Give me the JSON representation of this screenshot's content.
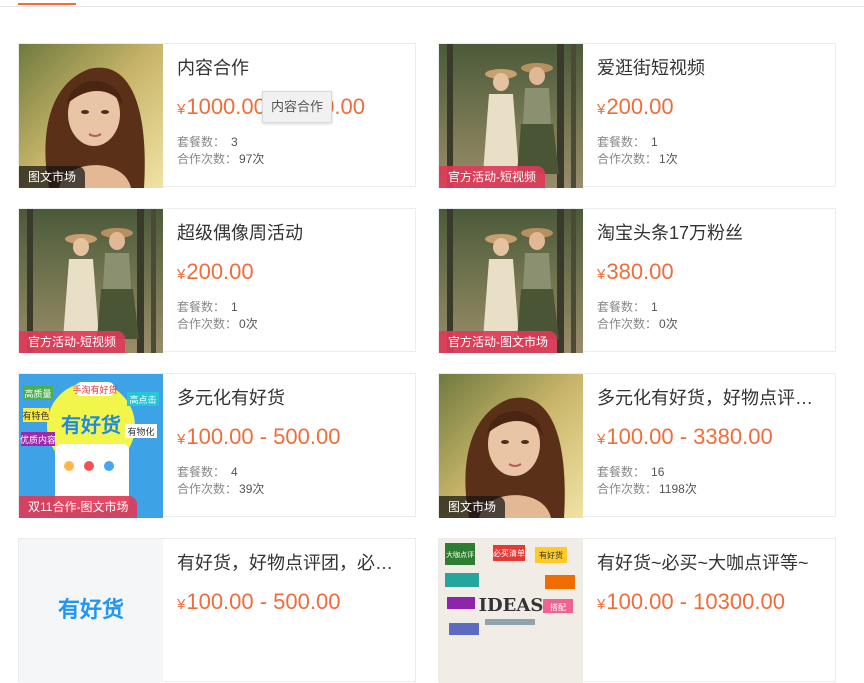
{
  "colors": {
    "accent": "#ef6d3a",
    "badge_dark": "#222222",
    "badge_red": "#de3a58"
  },
  "labels": {
    "package_count": "套餐数：",
    "cooperation_count": "合作次数：",
    "currency": "¥"
  },
  "tooltip": "内容合作",
  "cards": [
    {
      "title": "内容合作",
      "price": "1000.00 - 5000.00",
      "packages": "3",
      "cooperations": "97次",
      "badge": "图文市场",
      "image": "woman-portrait-photo"
    },
    {
      "title": "爱逛街短视频",
      "price": "200.00",
      "packages": "1",
      "cooperations": "1次",
      "badge": "官方活动-短视频",
      "image": "two-women-forest-photo"
    },
    {
      "title": "超级偶像周活动",
      "price": "200.00",
      "packages": "1",
      "cooperations": "0次",
      "badge": "官方活动-短视频",
      "image": "two-women-forest-photo"
    },
    {
      "title": "淘宝头条17万粉丝",
      "price": "380.00",
      "packages": "1",
      "cooperations": "0次",
      "badge": "官方活动-图文市场",
      "image": "two-women-forest-photo"
    },
    {
      "title": "多元化有好货",
      "price": "100.00 - 500.00",
      "packages": "4",
      "cooperations": "39次",
      "badge": "双11合作-图文市场",
      "image": "youhaohuo-promo",
      "promo_texts": [
        "高质量",
        "手淘有好货",
        "优质内容",
        "有好货",
        "有特色",
        "有物化",
        "高点击"
      ]
    },
    {
      "title": "多元化有好货，好物点评，必买清单",
      "price": "100.00 - 3380.00",
      "packages": "16",
      "cooperations": "1198次",
      "badge": "图文市场",
      "image": "woman-portrait-photo"
    },
    {
      "title": "有好货，好物点评团，必买清单",
      "price": "100.00 - 500.00",
      "packages": "",
      "cooperations": "",
      "badge": "",
      "image": "youhaohuo-logo",
      "logo_text": "有好货"
    },
    {
      "title": "有好货~必买~大咖点评等~",
      "price": "100.00 - 10300.00",
      "packages": "",
      "cooperations": "",
      "badge": "",
      "image": "ideas-collage",
      "collage_texts": [
        "大咖点评",
        "必买清单",
        "有好货",
        "IDEAS",
        "搭配"
      ]
    }
  ]
}
